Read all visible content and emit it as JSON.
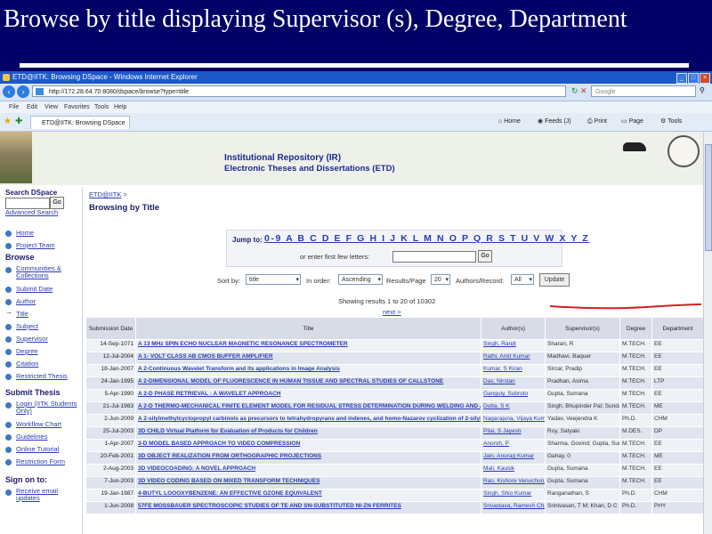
{
  "slide": {
    "title": "Browse by title displaying Supervisor (s), Degree, Department"
  },
  "browser": {
    "title": "ETD@IITK: Browsing DSpace - Windows Internet Explorer",
    "address": "http://172.28.64.70:8080/dspace/browse?type=title",
    "search_placeholder": "Google",
    "menu": [
      "File",
      "Edit",
      "View",
      "Favorites",
      "Tools",
      "Help"
    ],
    "tab": "ETD@IITK: Browsing DSpace",
    "tools": [
      "Home",
      "Feeds (J)",
      "Print",
      "Page",
      "Tools"
    ]
  },
  "banner": {
    "title": "Institutional Repository (IR)",
    "subtitle": "Electronic Theses and Dissertations (ETD)"
  },
  "sidebar": {
    "search_heading": "Search DSpace",
    "go_label": "Go",
    "advanced": "Advanced Search",
    "top_links": [
      "Home",
      "Project Team"
    ],
    "browse_heading": "Browse",
    "browse_links": [
      "Communities & Collections",
      "Submit Date",
      "Author",
      "Title",
      "Subject",
      "Supervisor",
      "Degree",
      "Citation",
      "Restricted Thesis"
    ],
    "submit_heading": "Submit Thesis",
    "submit_links": [
      "Login (IITK Students Only)",
      "Workflow Chart",
      "Guidelines",
      "Online Tutorial",
      "Restriction Form"
    ],
    "signon_heading": "Sign on to:",
    "signon_links": [
      "Receive email updates"
    ]
  },
  "main": {
    "crumb": "ETD@IITK",
    "heading": "Browsing by Title",
    "jump_label": "Jump to:",
    "letters": "0-9 A B C D E F G H I J K L M N O P Q R S T U V W X Y Z",
    "or_text": "or enter first few letters:",
    "go_label": "Go",
    "sort_by_label": "Sort by:",
    "sort_by_value": "title",
    "in_order_label": "In order:",
    "in_order_value": "Ascending",
    "results_label": "Results/Page",
    "results_value": "20",
    "authors_label": "Authors/Record:",
    "authors_value": "All",
    "update_label": "Update",
    "showing": "Showing results 1 to 20 of 10302",
    "next": "next >"
  },
  "table": {
    "headers": [
      "Submission Date",
      "Title",
      "Author(s)",
      "Supervisor(s)",
      "Degree",
      "Department"
    ],
    "rows": [
      [
        "14-Sep-1071",
        "A 13 MHz SPIN ECHO NUCLEAR MAGNETIC RESONANCE SPECTROMETER",
        "Singh, Ranjit",
        "Sharan, R",
        "M.TECH.",
        "EE"
      ],
      [
        "12-Jul-2004",
        "A 1- VOLT CLASS AB CMOS BUFFER AMPLIFIER",
        "Rathi, Amit Kumar",
        "Madhavi, Baquer",
        "M.TECH.",
        "EE"
      ],
      [
        "18-Jan-2007",
        "A 2-Continuous Wavelet Transform and its applications in Image Analysis",
        "Kumar, S Kiran",
        "Sircar, Pradip",
        "M.TECH.",
        "EE"
      ],
      [
        "24-Jan-1995",
        "A 2-DIMENSIONAL MODEL OF FLUORESCENCE IN HUMAN TISSUE AND SPECTRAL STUDIES OF CALLSTONE",
        "Das, Nirstan",
        "Pradhan, Asima",
        "M.TECH.",
        "LTP"
      ],
      [
        "5-Apr-1990",
        "A 2-D PHASE RETRIEVAL : A WAVELET APPROACH",
        "Ganguly, Subroto",
        "Gupta, Sumana",
        "M.TECH.",
        "EE"
      ],
      [
        "21-Jul-1983",
        "A 2-D THERMO-MECHANICAL FINITE ELEMENT MODEL FOR RESIDUAL STRESS DETERMINATION DURING WELDING AND ANNEALING",
        "Dutta, S K",
        "Singh, Bhupinder Pal; Sundararajan. V",
        "M.TECH.",
        "ME"
      ],
      [
        "2-Jun-2009",
        "A 2-silylmethylcyclopropyl carbinols as precursors to tetrahydropyrans and indenes, and homo-Nazarov cyclization of 2-silylmethylcyclopropyl heteroaryl ketones",
        "Nagarajuna, Vijaya Kumar",
        "Yadav, Veejendra K",
        "Ph.D.",
        "CHM"
      ],
      [
        "25-Jul-2003",
        "3D CHILD Virtual Platform for Evaluation of Products for Children",
        "Pilai, S Jayesh",
        "Roy, Satyaki",
        "M.DES.",
        "DP"
      ],
      [
        "1-Apr-2007",
        "3-D MODEL BASED APPROACH TO VIDEO COMPRESSION",
        "Anoroh, P",
        "Sharma, Govind; Gupta, Sumana",
        "M.TECH.",
        "EE"
      ],
      [
        "20-Feb-2001",
        "3D OBJECT REALIZATION FROM ORTHOGRAPHIC PROJECTIONS",
        "Jain, Anurag Kumar",
        "Gahay, 0",
        "M.TECH.",
        "ME"
      ],
      [
        "2-Aug-2003",
        "3D VIDEOCOADING: A NOVEL APPROACH",
        "Mali, Kausik",
        "Gupta, Sumana",
        "M.TECH.",
        "EE"
      ],
      [
        "7-Jun-2003",
        "3D VIDEO CODING BASED ON MIXED TRANSFORM TECHNIQUES",
        "Rao, Kishore Venuchuru",
        "Gupta, Sumana",
        "M.TECH.",
        "EE"
      ],
      [
        "19-Jan-1987",
        "4-BUTYL LOOOXYBENZENE: AN EFFECTIVE OZONE EQUIVALENT",
        "Singh, Shio Kumar",
        "Ranganathan, S",
        "Ph.D.",
        "CHM"
      ],
      [
        "1-Jun-2008",
        "57FE MOSSBAUER SPECTROSCOPIC STUDIES OF TE AND SN-SUBSTITUTED NI-ZN FERRITES",
        "Srivastava, Ramesh Chandra",
        "Srinivasan, T M; Khan, D C",
        "Ph.D.",
        "PHY"
      ]
    ]
  }
}
